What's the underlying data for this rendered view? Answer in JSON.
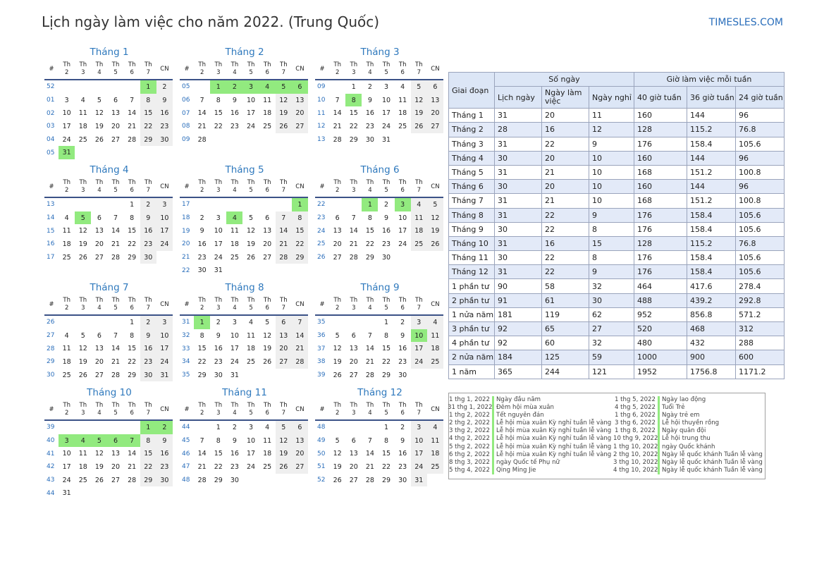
{
  "title": "Lịch ngày làm việc cho năm 2022. (Trung Quốc)",
  "site": "TIMESLES.COM",
  "dow": [
    "Th 2",
    "Th 3",
    "Th 4",
    "Th 5",
    "Th 6",
    "Th 7",
    "CN"
  ],
  "week_header": "#",
  "months": [
    {
      "name": "Tháng 1",
      "weeks": [
        [
          "52",
          null,
          null,
          null,
          null,
          null,
          "1",
          "2"
        ],
        [
          "01",
          "3",
          "4",
          "5",
          "6",
          "7",
          "8",
          "9"
        ],
        [
          "02",
          "10",
          "11",
          "12",
          "13",
          "14",
          "15",
          "16"
        ],
        [
          "03",
          "17",
          "18",
          "19",
          "20",
          "21",
          "22",
          "23"
        ],
        [
          "04",
          "24",
          "25",
          "26",
          "27",
          "28",
          "29",
          "30"
        ],
        [
          "05",
          "31",
          null,
          null,
          null,
          null,
          null,
          null
        ]
      ],
      "holidays": [
        "1",
        "31"
      ],
      "workweekend": []
    },
    {
      "name": "Tháng 2",
      "weeks": [
        [
          "05",
          null,
          "1",
          "2",
          "3",
          "4",
          "5",
          "6"
        ],
        [
          "06",
          "7",
          "8",
          "9",
          "10",
          "11",
          "12",
          "13"
        ],
        [
          "07",
          "14",
          "15",
          "16",
          "17",
          "18",
          "19",
          "20"
        ],
        [
          "08",
          "21",
          "22",
          "23",
          "24",
          "25",
          "26",
          "27"
        ],
        [
          "09",
          "28",
          null,
          null,
          null,
          null,
          null,
          null
        ]
      ],
      "holidays": [
        "1",
        "2",
        "3",
        "4",
        "5",
        "6"
      ],
      "workweekend": []
    },
    {
      "name": "Tháng 3",
      "weeks": [
        [
          "09",
          null,
          "1",
          "2",
          "3",
          "4",
          "5",
          "6"
        ],
        [
          "10",
          "7",
          "8",
          "9",
          "10",
          "11",
          "12",
          "13"
        ],
        [
          "11",
          "14",
          "15",
          "16",
          "17",
          "18",
          "19",
          "20"
        ],
        [
          "12",
          "21",
          "22",
          "23",
          "24",
          "25",
          "26",
          "27"
        ],
        [
          "13",
          "28",
          "29",
          "30",
          "31",
          null,
          null,
          null
        ]
      ],
      "holidays": [
        "8"
      ],
      "workweekend": []
    },
    {
      "name": "Tháng 4",
      "weeks": [
        [
          "13",
          null,
          null,
          null,
          null,
          "1",
          "2",
          "3"
        ],
        [
          "14",
          "4",
          "5",
          "6",
          "7",
          "8",
          "9",
          "10"
        ],
        [
          "15",
          "11",
          "12",
          "13",
          "14",
          "15",
          "16",
          "17"
        ],
        [
          "16",
          "18",
          "19",
          "20",
          "21",
          "22",
          "23",
          "24"
        ],
        [
          "17",
          "25",
          "26",
          "27",
          "28",
          "29",
          "30",
          null
        ]
      ],
      "holidays": [
        "5"
      ],
      "workweekend": []
    },
    {
      "name": "Tháng 5",
      "weeks": [
        [
          "17",
          null,
          null,
          null,
          null,
          null,
          null,
          "1"
        ],
        [
          "18",
          "2",
          "3",
          "4",
          "5",
          "6",
          "7",
          "8"
        ],
        [
          "19",
          "9",
          "10",
          "11",
          "12",
          "13",
          "14",
          "15"
        ],
        [
          "20",
          "16",
          "17",
          "18",
          "19",
          "20",
          "21",
          "22"
        ],
        [
          "21",
          "23",
          "24",
          "25",
          "26",
          "27",
          "28",
          "29"
        ],
        [
          "22",
          "30",
          "31",
          null,
          null,
          null,
          null,
          null
        ]
      ],
      "holidays": [
        "1",
        "4"
      ],
      "workweekend": []
    },
    {
      "name": "Tháng 6",
      "weeks": [
        [
          "22",
          null,
          null,
          "1",
          "2",
          "3",
          "4",
          "5"
        ],
        [
          "23",
          "6",
          "7",
          "8",
          "9",
          "10",
          "11",
          "12"
        ],
        [
          "24",
          "13",
          "14",
          "15",
          "16",
          "17",
          "18",
          "19"
        ],
        [
          "25",
          "20",
          "21",
          "22",
          "23",
          "24",
          "25",
          "26"
        ],
        [
          "26",
          "27",
          "28",
          "29",
          "30",
          null,
          null,
          null
        ]
      ],
      "holidays": [
        "1",
        "3"
      ],
      "workweekend": []
    },
    {
      "name": "Tháng 7",
      "weeks": [
        [
          "26",
          null,
          null,
          null,
          null,
          "1",
          "2",
          "3"
        ],
        [
          "27",
          "4",
          "5",
          "6",
          "7",
          "8",
          "9",
          "10"
        ],
        [
          "28",
          "11",
          "12",
          "13",
          "14",
          "15",
          "16",
          "17"
        ],
        [
          "29",
          "18",
          "19",
          "20",
          "21",
          "22",
          "23",
          "24"
        ],
        [
          "30",
          "25",
          "26",
          "27",
          "28",
          "29",
          "30",
          "31"
        ]
      ],
      "holidays": [],
      "workweekend": []
    },
    {
      "name": "Tháng 8",
      "weeks": [
        [
          "31",
          "1",
          "2",
          "3",
          "4",
          "5",
          "6",
          "7"
        ],
        [
          "32",
          "8",
          "9",
          "10",
          "11",
          "12",
          "13",
          "14"
        ],
        [
          "33",
          "15",
          "16",
          "17",
          "18",
          "19",
          "20",
          "21"
        ],
        [
          "34",
          "22",
          "23",
          "24",
          "25",
          "26",
          "27",
          "28"
        ],
        [
          "35",
          "29",
          "30",
          "31",
          null,
          null,
          null,
          null
        ]
      ],
      "holidays": [
        "1"
      ],
      "workweekend": []
    },
    {
      "name": "Tháng 9",
      "weeks": [
        [
          "35",
          null,
          null,
          null,
          "1",
          "2",
          "3",
          "4"
        ],
        [
          "36",
          "5",
          "6",
          "7",
          "8",
          "9",
          "10",
          "11"
        ],
        [
          "37",
          "12",
          "13",
          "14",
          "15",
          "16",
          "17",
          "18"
        ],
        [
          "38",
          "19",
          "20",
          "21",
          "22",
          "23",
          "24",
          "25"
        ],
        [
          "39",
          "26",
          "27",
          "28",
          "29",
          "30",
          null,
          null
        ]
      ],
      "holidays": [
        "10"
      ],
      "workweekend": []
    },
    {
      "name": "Tháng 10",
      "weeks": [
        [
          "39",
          null,
          null,
          null,
          null,
          null,
          "1",
          "2"
        ],
        [
          "40",
          "3",
          "4",
          "5",
          "6",
          "7",
          "8",
          "9"
        ],
        [
          "41",
          "10",
          "11",
          "12",
          "13",
          "14",
          "15",
          "16"
        ],
        [
          "42",
          "17",
          "18",
          "19",
          "20",
          "21",
          "22",
          "23"
        ],
        [
          "43",
          "24",
          "25",
          "26",
          "27",
          "28",
          "29",
          "30"
        ],
        [
          "44",
          "31",
          null,
          null,
          null,
          null,
          null,
          null
        ]
      ],
      "holidays": [
        "1",
        "2",
        "3",
        "4",
        "5",
        "6",
        "7"
      ],
      "workweekend": []
    },
    {
      "name": "Tháng 11",
      "weeks": [
        [
          "44",
          null,
          "1",
          "2",
          "3",
          "4",
          "5",
          "6"
        ],
        [
          "45",
          "7",
          "8",
          "9",
          "10",
          "11",
          "12",
          "13"
        ],
        [
          "46",
          "14",
          "15",
          "16",
          "17",
          "18",
          "19",
          "20"
        ],
        [
          "47",
          "21",
          "22",
          "23",
          "24",
          "25",
          "26",
          "27"
        ],
        [
          "48",
          "28",
          "29",
          "30",
          null,
          null,
          null,
          null
        ]
      ],
      "holidays": [],
      "workweekend": []
    },
    {
      "name": "Tháng 12",
      "weeks": [
        [
          "48",
          null,
          null,
          null,
          "1",
          "2",
          "3",
          "4"
        ],
        [
          "49",
          "5",
          "6",
          "7",
          "8",
          "9",
          "10",
          "11"
        ],
        [
          "50",
          "12",
          "13",
          "14",
          "15",
          "16",
          "17",
          "18"
        ],
        [
          "51",
          "19",
          "20",
          "21",
          "22",
          "23",
          "24",
          "25"
        ],
        [
          "52",
          "26",
          "27",
          "28",
          "29",
          "30",
          "31",
          null
        ]
      ],
      "holidays": [],
      "workweekend": []
    }
  ],
  "stats": {
    "h_period": "Giai đoạn",
    "h_days": "Số ngày",
    "h_hours": "Giờ làm việc mỗi tuần",
    "h_cal": "Lịch ngày",
    "h_work": "Ngày làm việc",
    "h_off": "Ngày nghỉ",
    "h_40": "40 giờ tuần",
    "h_36": "36 giờ tuần",
    "h_24": "24 giờ tuần",
    "rows": [
      [
        "Tháng 1",
        "31",
        "20",
        "11",
        "160",
        "144",
        "96"
      ],
      [
        "Tháng 2",
        "28",
        "16",
        "12",
        "128",
        "115.2",
        "76.8"
      ],
      [
        "Tháng 3",
        "31",
        "22",
        "9",
        "176",
        "158.4",
        "105.6"
      ],
      [
        "Tháng 4",
        "30",
        "20",
        "10",
        "160",
        "144",
        "96"
      ],
      [
        "Tháng 5",
        "31",
        "21",
        "10",
        "168",
        "151.2",
        "100.8"
      ],
      [
        "Tháng 6",
        "30",
        "20",
        "10",
        "160",
        "144",
        "96"
      ],
      [
        "Tháng 7",
        "31",
        "21",
        "10",
        "168",
        "151.2",
        "100.8"
      ],
      [
        "Tháng 8",
        "31",
        "22",
        "9",
        "176",
        "158.4",
        "105.6"
      ],
      [
        "Tháng 9",
        "30",
        "22",
        "8",
        "176",
        "158.4",
        "105.6"
      ],
      [
        "Tháng 10",
        "31",
        "16",
        "15",
        "128",
        "115.2",
        "76.8"
      ],
      [
        "Tháng 11",
        "30",
        "22",
        "8",
        "176",
        "158.4",
        "105.6"
      ],
      [
        "Tháng 12",
        "31",
        "22",
        "9",
        "176",
        "158.4",
        "105.6"
      ],
      [
        "1 phần tư",
        "90",
        "58",
        "32",
        "464",
        "417.6",
        "278.4"
      ],
      [
        "2 phần tư",
        "91",
        "61",
        "30",
        "488",
        "439.2",
        "292.8"
      ],
      [
        "1 nửa năm",
        "181",
        "119",
        "62",
        "952",
        "856.8",
        "571.2"
      ],
      [
        "3 phần tư",
        "92",
        "65",
        "27",
        "520",
        "468",
        "312"
      ],
      [
        "4 phần tư",
        "92",
        "60",
        "32",
        "480",
        "432",
        "288"
      ],
      [
        "2 nửa năm",
        "184",
        "125",
        "59",
        "1000",
        "900",
        "600"
      ],
      [
        "1 năm",
        "365",
        "244",
        "121",
        "1952",
        "1756.8",
        "1171.2"
      ]
    ]
  },
  "holidays_left": [
    [
      "1 thg 1, 2022",
      "Ngày đầu năm"
    ],
    [
      "31 thg 1, 2022",
      "Đêm hội mùa xuân"
    ],
    [
      "1 thg 2, 2022",
      "Tết nguyên đán"
    ],
    [
      "2 thg 2, 2022",
      "Lễ hội mùa xuân Kỳ nghỉ tuần lễ vàng"
    ],
    [
      "3 thg 2, 2022",
      "Lễ hội mùa xuân Kỳ nghỉ tuần lễ vàng"
    ],
    [
      "4 thg 2, 2022",
      "Lễ hội mùa xuân Kỳ nghỉ tuần lễ vàng"
    ],
    [
      "5 thg 2, 2022",
      "Lễ hội mùa xuân Kỳ nghỉ tuần lễ vàng"
    ],
    [
      "6 thg 2, 2022",
      "Lễ hội mùa xuân Kỳ nghỉ tuần lễ vàng"
    ],
    [
      "8 thg 3, 2022",
      "ngày Quốc tế Phụ nữ"
    ],
    [
      "5 thg 4, 2022",
      "Qing Ming Jie"
    ]
  ],
  "holidays_right": [
    [
      "1 thg 5, 2022",
      "Ngày lao động"
    ],
    [
      "4 thg 5, 2022",
      "Tuổi Trẻ"
    ],
    [
      "1 thg 6, 2022",
      "Ngày trẻ em"
    ],
    [
      "3 thg 6, 2022",
      "Lễ hội thuyền rồng"
    ],
    [
      "1 thg 8, 2022",
      "Ngày quân đội"
    ],
    [
      "10 thg 9, 2022",
      "Lễ hội trung thu"
    ],
    [
      "1 thg 10, 2022",
      "ngày Quốc khánh"
    ],
    [
      "2 thg 10, 2022",
      "Ngày lễ quốc khánh Tuần lễ vàng"
    ],
    [
      "3 thg 10, 2022",
      "Ngày lễ quốc khánh Tuần lễ vàng"
    ],
    [
      "4 thg 10, 2022",
      "Ngày lễ quốc khánh Tuần lễ vàng"
    ]
  ]
}
